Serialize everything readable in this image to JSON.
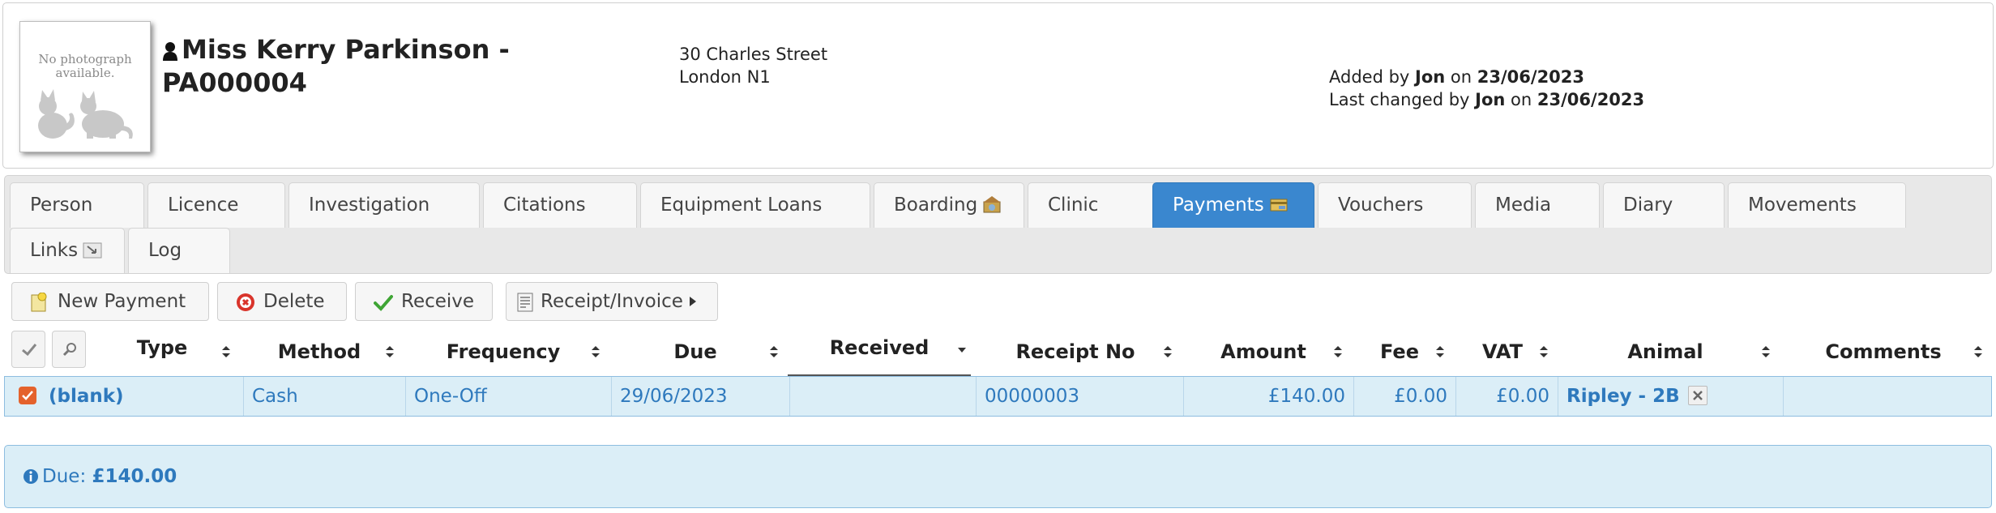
{
  "header": {
    "photo_text_line1": "No photograph",
    "photo_text_line2": "available.",
    "title_line1": "Miss Kerry Parkinson -",
    "title_line2": "PA000004",
    "address_line1": "30 Charles Street",
    "address_line2": "London N1",
    "added_by_prefix": "Added by",
    "added_by_user": "Jon",
    "added_on_word": "on",
    "added_date": "23/06/2023",
    "changed_by_prefix": "Last changed by",
    "changed_by_user": "Jon",
    "changed_on_word": "on",
    "changed_date": "23/06/2023"
  },
  "tabs": [
    {
      "label": "Person",
      "icon": ""
    },
    {
      "label": "Licence",
      "icon": ""
    },
    {
      "label": "Investigation",
      "icon": ""
    },
    {
      "label": "Citations",
      "icon": ""
    },
    {
      "label": "Equipment Loans",
      "icon": ""
    },
    {
      "label": "Boarding",
      "icon": "boarding-icon"
    },
    {
      "label": "Clinic",
      "icon": ""
    },
    {
      "label": "Payments",
      "icon": "payments-icon",
      "active": true
    },
    {
      "label": "Vouchers",
      "icon": ""
    },
    {
      "label": "Media",
      "icon": ""
    },
    {
      "label": "Diary",
      "icon": ""
    },
    {
      "label": "Movements",
      "icon": ""
    },
    {
      "label": "Links",
      "icon": "links-icon"
    },
    {
      "label": "Log",
      "icon": ""
    }
  ],
  "toolbar": {
    "new_payment": "New Payment",
    "delete": "Delete",
    "receive": "Receive",
    "receipt_invoice": "Receipt/Invoice"
  },
  "table": {
    "columns": [
      "Type",
      "Method",
      "Frequency",
      "Due",
      "Received",
      "Receipt No",
      "Amount",
      "Fee",
      "VAT",
      "Animal",
      "Comments"
    ],
    "sorted_column": "Received",
    "rows": [
      {
        "checked": true,
        "type": "(blank)",
        "method": "Cash",
        "frequency": "One-Off",
        "due": "29/06/2023",
        "received": "",
        "receipt_no": "00000003",
        "amount": "£140.00",
        "fee": "£0.00",
        "vat": "£0.00",
        "animal": "Ripley - 2B",
        "comments": ""
      }
    ]
  },
  "summary": {
    "due_label": "Due:",
    "due_value": "£140.00"
  },
  "colors": {
    "accent": "#3a87cf",
    "row_bg": "#dbeef7",
    "link_text": "#2e79bd",
    "checkbox": "#e4622c"
  }
}
